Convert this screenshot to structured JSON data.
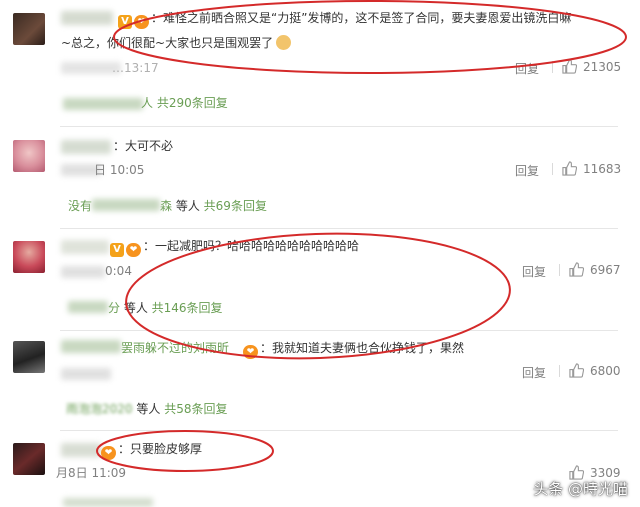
{
  "comments": [
    {
      "text_line1": "：难怪之前晒合照又是“力挺”发博的，这不是签了合同，要夫妻恩爱出镜洗白嘛",
      "text_line2": "~总之，你们很配~大家也只是围观罢了",
      "time": "…13:17",
      "reply_label": "回复",
      "likes": "21305",
      "sub_reply": "人 共290条回复"
    },
    {
      "text": "：大可不必",
      "time": "日 10:05",
      "reply_label": "回复",
      "likes": "11683",
      "sub_prefix": "没有",
      "sub_name_tail": "森",
      "sub_mid": " 等人 ",
      "sub_count": "共69条回复"
    },
    {
      "text": "：一起减肥吗？哈哈哈哈哈哈哈哈哈哈哈",
      "time": "0:04",
      "reply_label": "回复",
      "likes": "6967",
      "sub_name_tail": "分",
      "sub_mid": " 等人 ",
      "sub_count": "共146条回复"
    },
    {
      "name_visible": "罢雨躲不过的刘雨昕",
      "text": "：我就知道夫妻俩也合伙挣钱了，果然",
      "time": "",
      "reply_label": "回复",
      "likes": "6800",
      "sub_name": "雨泡泡2020",
      "sub_mid": " 等人 ",
      "sub_count": "共58条回复"
    },
    {
      "text": "：只要脸皮够厚",
      "time": "月8日 11:09",
      "likes": "3309"
    }
  ],
  "watermark": "头条 @時光喵",
  "colors": {
    "link_green": "#6a9e54",
    "time_gray": "#808080",
    "annotation_red": "#d42a2a",
    "badge_orange": "#f4a21a"
  }
}
